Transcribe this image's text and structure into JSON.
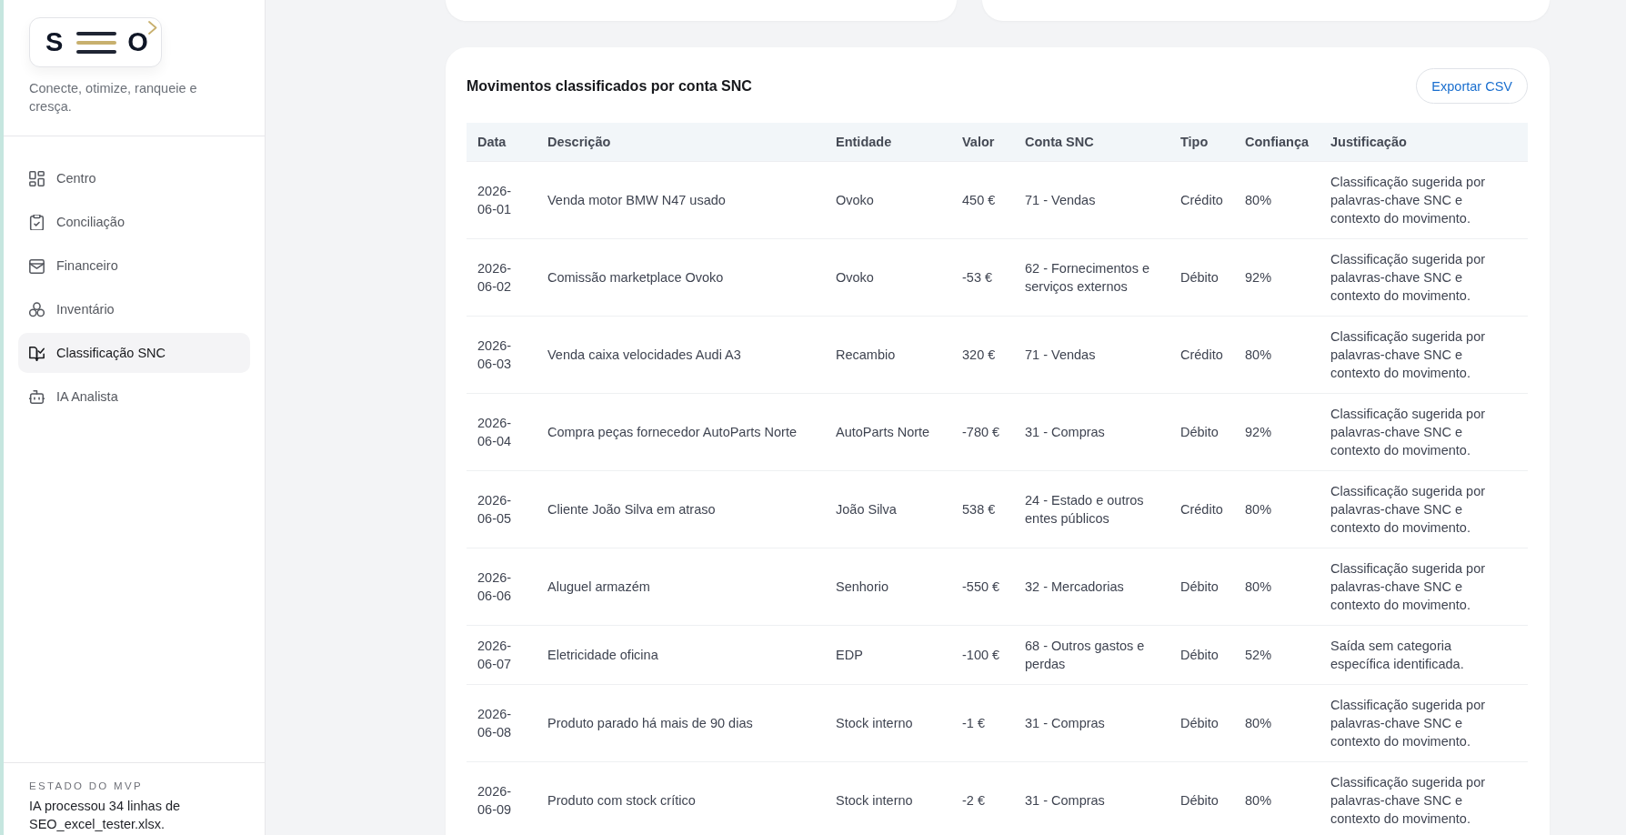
{
  "sidebar": {
    "logo": {
      "left_letter": "S",
      "right_letter": "O"
    },
    "tagline": "Conecte, otimize, ranqueie e cresça.",
    "nav_items": [
      {
        "label": "Centro",
        "selected": false
      },
      {
        "label": "Conciliação",
        "selected": false
      },
      {
        "label": "Financeiro",
        "selected": false
      },
      {
        "label": "Inventário",
        "selected": false
      },
      {
        "label": "Classificação SNC",
        "selected": true
      },
      {
        "label": "IA Analista",
        "selected": false
      }
    ],
    "status": {
      "heading": "ESTADO DO MVP",
      "text": "IA processou 34 linhas de SEO_excel_tester.xlsx."
    }
  },
  "classification_panel": {
    "title": "Movimentos classificados por conta SNC",
    "export_button": "Exportar CSV",
    "table": {
      "columns": [
        "Data",
        "Descrição",
        "Entidade",
        "Valor",
        "Conta SNC",
        "Tipo",
        "Confiança",
        "Justificação"
      ],
      "rows": [
        {
          "date": "2026-06-01",
          "description": "Venda motor BMW N47 usado",
          "entity": "Ovoko",
          "value": "450 €",
          "account": "71 - Vendas",
          "type": "Crédito",
          "confidence": "80%",
          "justification": "Classificação sugerida por palavras-chave SNC e contexto do movimento."
        },
        {
          "date": "2026-06-02",
          "description": "Comissão marketplace Ovoko",
          "entity": "Ovoko",
          "value": "-53 €",
          "account": "62 - Fornecimentos e serviços externos",
          "type": "Débito",
          "confidence": "92%",
          "justification": "Classificação sugerida por palavras-chave SNC e contexto do movimento."
        },
        {
          "date": "2026-06-03",
          "description": "Venda caixa velocidades Audi A3",
          "entity": "Recambio",
          "value": "320 €",
          "account": "71 - Vendas",
          "type": "Crédito",
          "confidence": "80%",
          "justification": "Classificação sugerida por palavras-chave SNC e contexto do movimento."
        },
        {
          "date": "2026-06-04",
          "description": "Compra peças fornecedor AutoParts Norte",
          "entity": "AutoParts Norte",
          "value": "-780 €",
          "account": "31 - Compras",
          "type": "Débito",
          "confidence": "92%",
          "justification": "Classificação sugerida por palavras-chave SNC e contexto do movimento."
        },
        {
          "date": "2026-06-05",
          "description": "Cliente João Silva em atraso",
          "entity": "João Silva",
          "value": "538 €",
          "account": "24 - Estado e outros entes públicos",
          "type": "Crédito",
          "confidence": "80%",
          "justification": "Classificação sugerida por palavras-chave SNC e contexto do movimento."
        },
        {
          "date": "2026-06-06",
          "description": "Aluguel armazém",
          "entity": "Senhorio",
          "value": "-550 €",
          "account": "32 - Mercadorias",
          "type": "Débito",
          "confidence": "80%",
          "justification": "Classificação sugerida por palavras-chave SNC e contexto do movimento."
        },
        {
          "date": "2026-06-07",
          "description": "Eletricidade oficina",
          "entity": "EDP",
          "value": "-100 €",
          "account": "68 - Outros gastos e perdas",
          "type": "Débito",
          "confidence": "52%",
          "justification": "Saída sem categoria específica identificada."
        },
        {
          "date": "2026-06-08",
          "description": "Produto parado há mais de 90 dias",
          "entity": "Stock interno",
          "value": "-1 €",
          "account": "31 - Compras",
          "type": "Débito",
          "confidence": "80%",
          "justification": "Classificação sugerida por palavras-chave SNC e contexto do movimento."
        },
        {
          "date": "2026-06-09",
          "description": "Produto com stock crítico",
          "entity": "Stock interno",
          "value": "-2 €",
          "account": "31 - Compras",
          "type": "Débito",
          "confidence": "80%",
          "justification": "Classificação sugerida por palavras-chave SNC e contexto do movimento."
        }
      ]
    }
  }
}
